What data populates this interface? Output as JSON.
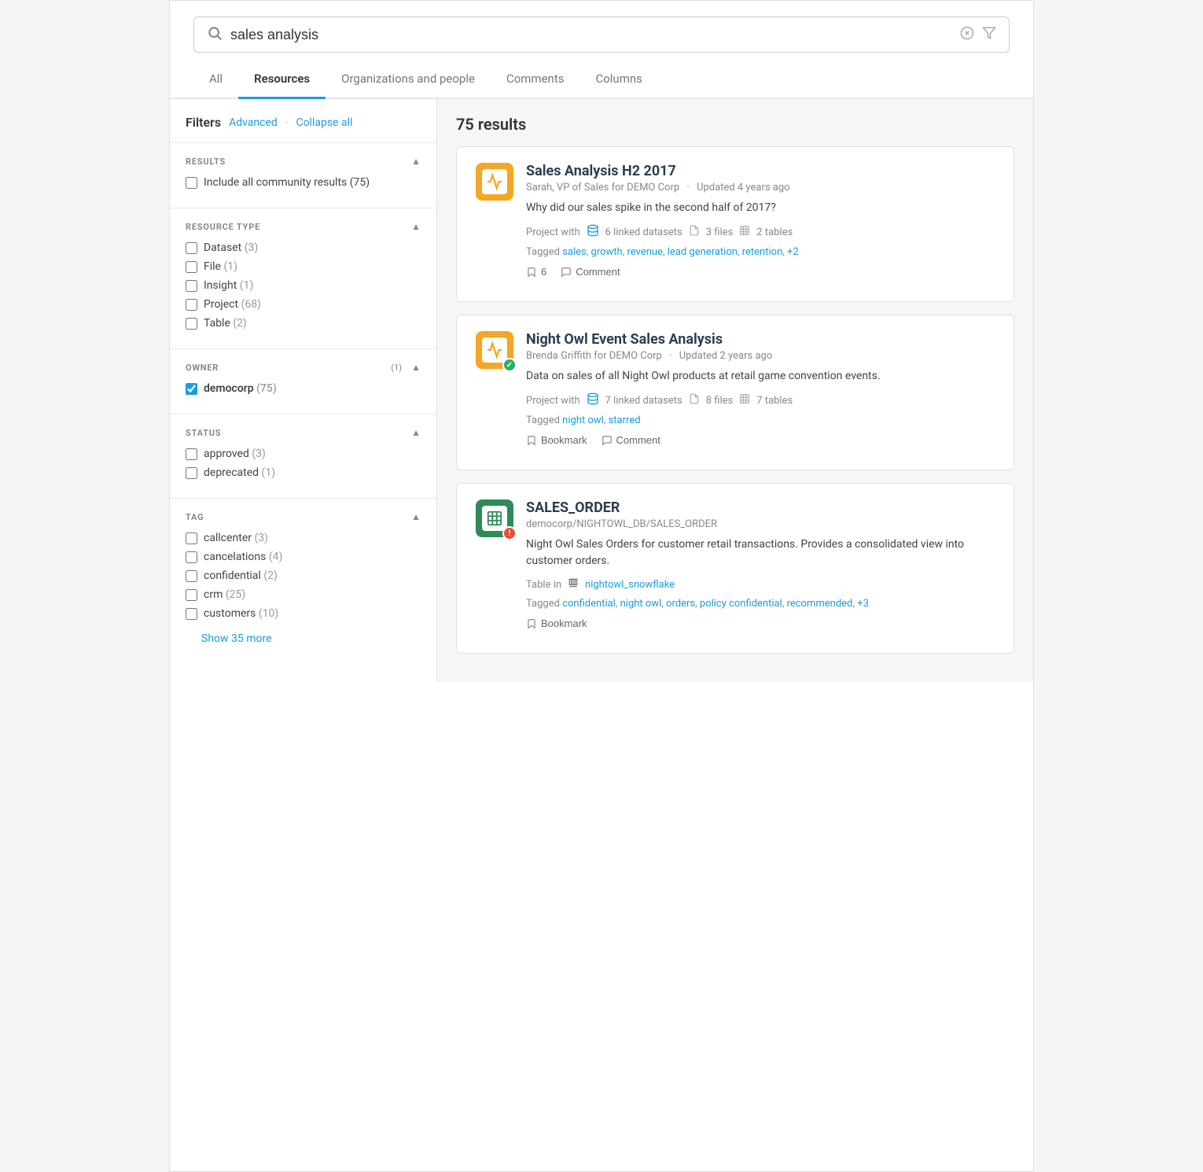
{
  "search": {
    "placeholder": "sales analysis",
    "value": "sales analysis"
  },
  "tabs": [
    {
      "label": "All",
      "active": false
    },
    {
      "label": "Resources",
      "active": true
    },
    {
      "label": "Organizations and people",
      "active": false
    },
    {
      "label": "Comments",
      "active": false
    },
    {
      "label": "Columns",
      "active": false
    }
  ],
  "filters": {
    "title": "Filters",
    "advanced_label": "Advanced",
    "collapse_label": "Collapse all",
    "results_count": "75 results",
    "sections": [
      {
        "id": "results",
        "title": "RESULTS",
        "count": null,
        "items": [
          {
            "label": "Include all community results (75)",
            "checked": false
          }
        ]
      },
      {
        "id": "resource_type",
        "title": "RESOURCE TYPE",
        "count": null,
        "items": [
          {
            "label": "Dataset",
            "count": "(3)",
            "checked": false
          },
          {
            "label": "File",
            "count": "(1)",
            "checked": false
          },
          {
            "label": "Insight",
            "count": "(1)",
            "checked": false
          },
          {
            "label": "Project",
            "count": "(68)",
            "checked": false
          },
          {
            "label": "Table",
            "count": "(2)",
            "checked": false
          }
        ]
      },
      {
        "id": "owner",
        "title": "OWNER",
        "count": "(1)",
        "items": [
          {
            "label": "democorp",
            "count": "(75)",
            "checked": true
          }
        ]
      },
      {
        "id": "status",
        "title": "STATUS",
        "count": null,
        "items": [
          {
            "label": "approved",
            "count": "(3)",
            "checked": false
          },
          {
            "label": "deprecated",
            "count": "(1)",
            "checked": false
          }
        ]
      },
      {
        "id": "tag",
        "title": "TAG",
        "count": null,
        "items": [
          {
            "label": "callcenter",
            "count": "(3)",
            "checked": false
          },
          {
            "label": "cancelations",
            "count": "(4)",
            "checked": false
          },
          {
            "label": "confidential",
            "count": "(2)",
            "checked": false
          },
          {
            "label": "crm",
            "count": "(25)",
            "checked": false
          },
          {
            "label": "customers",
            "count": "(10)",
            "checked": false
          }
        ]
      }
    ],
    "show_more_label": "Show 35 more"
  },
  "results": [
    {
      "id": "result1",
      "icon_type": "project_orange",
      "badge": null,
      "title": "Sales Analysis H2 2017",
      "subtitle_author": "Sarah, VP of Sales for DEMO Corp",
      "subtitle_time": "Updated 4 years ago",
      "description": "Why did our sales spike in the second half of 2017?",
      "meta": "Project with  6 linked datasets   3 files   2 tables",
      "meta_datasets": "6 linked datasets",
      "meta_files": "3 files",
      "meta_tables": "2 tables",
      "tags_label": "Tagged",
      "tags": [
        "sales",
        "growth",
        "revenue",
        "lead generation",
        "retention",
        "+2"
      ],
      "actions": [
        {
          "icon": "bookmark",
          "label": "6"
        },
        {
          "icon": "comment",
          "label": "Comment"
        }
      ]
    },
    {
      "id": "result2",
      "icon_type": "project_orange",
      "badge": "green_check",
      "title": "Night Owl Event Sales Analysis",
      "subtitle_author": "Brenda Griffith for DEMO Corp",
      "subtitle_time": "Updated 2 years ago",
      "description": "Data on sales of all Night Owl products at retail game convention events.",
      "meta_datasets": "7 linked datasets",
      "meta_files": "8 files",
      "meta_tables": "7 tables",
      "tags_label": "Tagged",
      "tags": [
        "night owl",
        "starred"
      ],
      "actions": [
        {
          "icon": "bookmark",
          "label": "Bookmark"
        },
        {
          "icon": "comment",
          "label": "Comment"
        }
      ]
    },
    {
      "id": "result3",
      "icon_type": "table_green",
      "badge": "red_exclaim",
      "title": "SALES_ORDER",
      "subtitle_path": "democorp/NIGHTOWL_DB/SALES_ORDER",
      "description": "Night Owl Sales Orders for customer retail transactions. Provides a consolidated view into customer orders.",
      "meta_type": "Table in",
      "meta_db": "nightowl_snowflake",
      "tags_label": "Tagged",
      "tags": [
        "confidential",
        "night owl",
        "orders",
        "policy confidential",
        "recommended",
        "+3"
      ],
      "actions": [
        {
          "icon": "bookmark",
          "label": "Bookmark"
        }
      ]
    }
  ]
}
